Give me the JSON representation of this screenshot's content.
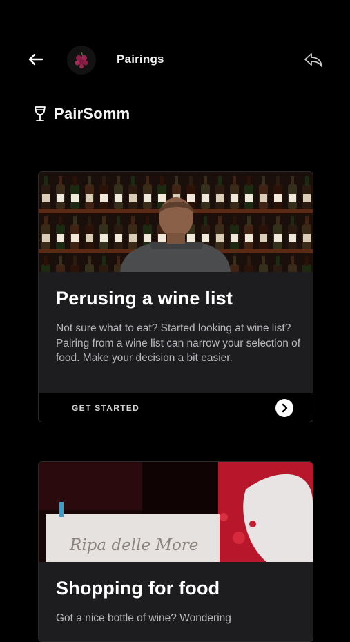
{
  "header": {
    "title": "Pairings",
    "back_icon": "arrow-left-icon",
    "avatar_icon": "grapes-icon",
    "share_icon": "share-icon"
  },
  "brand": {
    "name": "PairSomm",
    "icon": "wine-glass-icon"
  },
  "cards": [
    {
      "title": "Perusing a wine list",
      "description": "Not sure what to eat? Started looking at wine list? Pairing from a wine list can narrow your selection of food. Make your decision a bit easier.",
      "cta_label": "GET STARTED",
      "image": "man-facing-wine-shelves"
    },
    {
      "title": "Shopping for food",
      "description": "Got a nice bottle of wine? Wondering",
      "image": "wine-bottle-label",
      "image_label_text": "Ripa delle More"
    }
  ],
  "colors": {
    "background": "#000000",
    "card": "#1d1d1f",
    "text_primary": "#ffffff",
    "text_secondary": "#b8b8bc",
    "avatar_grape": "#8e1f4a"
  }
}
